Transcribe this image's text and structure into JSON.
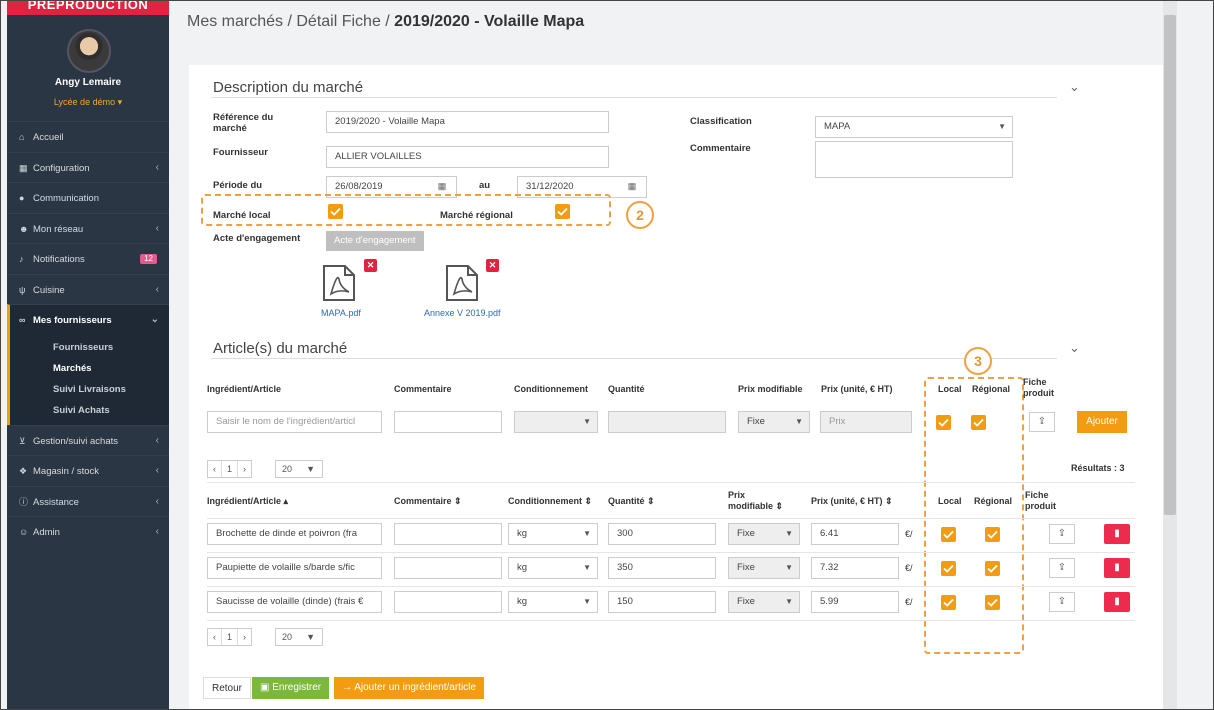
{
  "sidebar": {
    "banner": "PREPRODUCTION",
    "user_name": "Angy Lemaire",
    "school": "Lycée de démo ▾",
    "items": [
      {
        "label": "Accueil",
        "icon": "home-icon",
        "glyph": "⌂"
      },
      {
        "label": "Configuration",
        "icon": "bank-icon",
        "glyph": "▦"
      },
      {
        "label": "Communication",
        "icon": "chat-icon",
        "glyph": "●"
      },
      {
        "label": "Mon réseau",
        "icon": "users-icon",
        "glyph": "☻"
      },
      {
        "label": "Notifications",
        "icon": "bell-icon",
        "glyph": "♪",
        "badge": "12"
      },
      {
        "label": "Cuisine",
        "icon": "cutlery-icon",
        "glyph": "ψ"
      },
      {
        "label": "Mes fournisseurs",
        "icon": "handshake-icon",
        "glyph": "∞"
      }
    ],
    "subitems": [
      "Fournisseurs",
      "Marchés",
      "Suivi Livraisons",
      "Suivi Achats"
    ],
    "items_after": [
      {
        "label": "Gestion/suivi achats",
        "icon": "cart-icon",
        "glyph": "⊻"
      },
      {
        "label": "Magasin / stock",
        "icon": "cubes-icon",
        "glyph": "❖"
      },
      {
        "label": "Assistance",
        "icon": "info-icon",
        "glyph": "ⓘ"
      },
      {
        "label": "Admin",
        "icon": "user-plus-icon",
        "glyph": "☺"
      }
    ]
  },
  "breadcrumb": {
    "path": "Mes marchés / Détail Fiche / ",
    "current": "2019/2020 - Volaille Mapa"
  },
  "description": {
    "title": "Description du marché",
    "ref_label": "Référence du marché",
    "ref_value": "2019/2020 - Volaille Mapa",
    "supplier_label": "Fournisseur",
    "supplier_value": "ALLIER VOLAILLES",
    "period_label": "Période du",
    "date_from": "26/08/2019",
    "to_label": "au",
    "date_to": "31/12/2020",
    "local_label": "Marché local",
    "regional_label": "Marché régional",
    "engagement_label": "Acte d'engagement",
    "engagement_button": "Acte d'engagement",
    "classification_label": "Classification",
    "classification_value": "MAPA",
    "comment_label": "Commentaire",
    "files": [
      "MAPA.pdf",
      "Annexe V 2019.pdf"
    ]
  },
  "annotations": {
    "two": "2",
    "three": "3"
  },
  "articles": {
    "title": "Article(s) du marché",
    "headers": {
      "ingredient": "Ingrédient/Article",
      "comment": "Commentaire",
      "packaging": "Conditionnement",
      "quantity": "Quantité",
      "price_mod": "Prix modifiable",
      "price": "Prix (unité, € HT)",
      "local": "Local",
      "regional": "Régional",
      "fiche1": "Fiche",
      "fiche2": "produit"
    },
    "new_row": {
      "ingredient_placeholder": "Saisir le nom de l'ingrédient/articl",
      "price_mode": "Fixe",
      "price_placeholder": "Prix",
      "add_button": "Ajouter"
    },
    "pager": {
      "prev": "‹",
      "page": "1",
      "next": "›",
      "per_page": "20"
    },
    "results": "Résultats : 3",
    "table_headers": {
      "ingredient": "Ingrédient/Article ▴",
      "comment": "Commentaire ⇕",
      "packaging": "Conditionnement ⇕",
      "quantity": "Quantité ⇕",
      "price_mod1": "Prix",
      "price_mod2": "modifiable ⇕",
      "price": "Prix (unité, € HT) ⇕",
      "local": "Local",
      "regional": "Régional",
      "fiche1": "Fiche",
      "fiche2": "produit"
    },
    "rows": [
      {
        "ingredient": "Brochette de dinde et poivron (fra",
        "unit": "kg",
        "quantity": "300",
        "price_mode": "Fixe",
        "price": "6.41",
        "currency": "€/"
      },
      {
        "ingredient": "Paupiette de volaille s/barde s/fic",
        "unit": "kg",
        "quantity": "350",
        "price_mode": "Fixe",
        "price": "7.32",
        "currency": "€/"
      },
      {
        "ingredient": "Saucisse de volaille (dinde) (frais €",
        "unit": "kg",
        "quantity": "150",
        "price_mode": "Fixe",
        "price": "5.99",
        "currency": "€/"
      }
    ]
  },
  "footer": {
    "back": "Retour",
    "save": "Enregistrer",
    "add_article": "→ Ajouter un ingrédient/article"
  },
  "colors": {
    "accent": "#f39c12",
    "danger": "#e2233f",
    "success": "#7cb83b",
    "sidebar": "#2b3644"
  }
}
